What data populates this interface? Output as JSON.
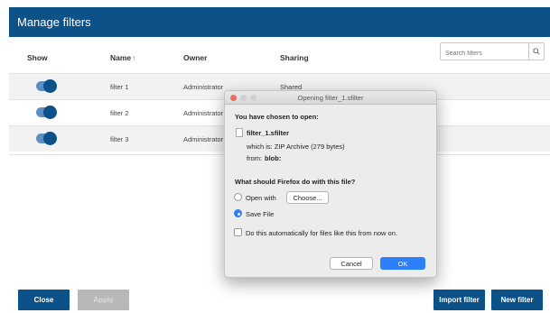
{
  "header": {
    "title": "Manage filters"
  },
  "columns": {
    "show": "Show",
    "name": "Name",
    "name_sort_icon": "↑",
    "owner": "Owner",
    "sharing": "Sharing"
  },
  "search": {
    "placeholder": "Search filters",
    "icon": "🔍"
  },
  "rows": [
    {
      "enabled": true,
      "name": "filter 1",
      "owner": "Administrator",
      "sharing": "Shared"
    },
    {
      "enabled": true,
      "name": "filter 2",
      "owner": "Administrator",
      "sharing": ""
    },
    {
      "enabled": true,
      "name": "filter 3",
      "owner": "Administrator",
      "sharing": ""
    }
  ],
  "buttons": {
    "close": "Close",
    "apply": "Apply",
    "import": "Import filter",
    "new": "New filter"
  },
  "dialog": {
    "title": "Opening filter_1.sfilter",
    "chosen": "You have chosen to open:",
    "filename": "filter_1.sfilter",
    "which_is": "which is: ZIP Archive (279 bytes)",
    "from_label": "from:",
    "from_value": "blob:",
    "question": "What should Firefox do with this file?",
    "open_with": "Open with",
    "choose": "Choose...",
    "save_file": "Save File",
    "auto": "Do this automatically for files like this from now on.",
    "cancel": "Cancel",
    "ok": "OK",
    "selected_option": "Save File"
  },
  "colors": {
    "brand": "#0d5189",
    "toggle_track": "#5b8fc3",
    "dialog_ok": "#2d7ff9"
  }
}
